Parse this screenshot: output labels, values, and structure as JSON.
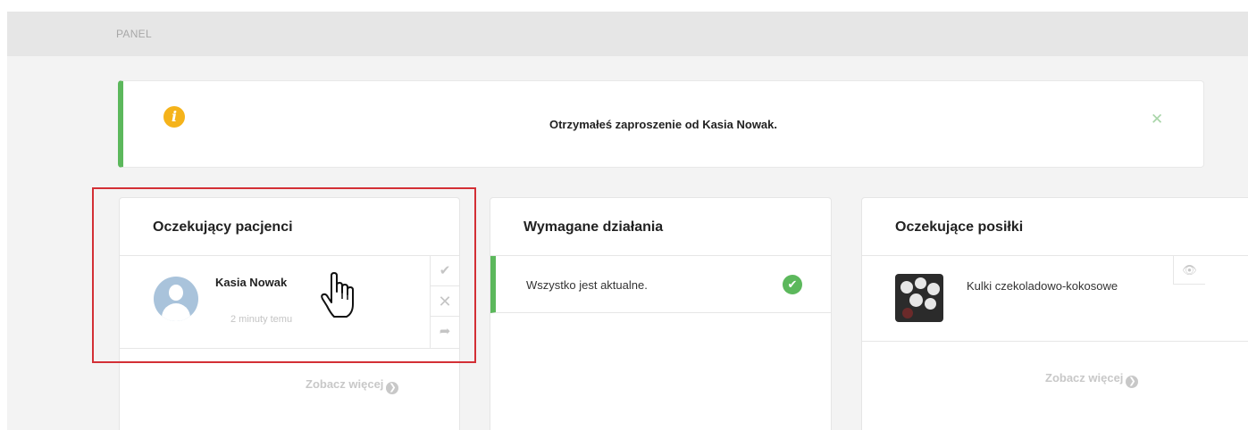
{
  "breadcrumb": {
    "label": "PANEL"
  },
  "alert": {
    "message": "Otrzymałeś zaproszenie od Kasia Nowak.",
    "info_glyph": "i",
    "close_glyph": "✕",
    "accent_color": "#5cb85c",
    "icon": "info-icon"
  },
  "patients_card": {
    "title": "Oczekujący pacjenci",
    "items": [
      {
        "name": "Kasia Nowak",
        "time": "2 minuty temu"
      }
    ],
    "actions": {
      "accept": "✔",
      "reject": "✕",
      "forward": "➦"
    },
    "see_more": "Zobacz więcej",
    "see_more_glyph": "❯"
  },
  "required_actions_card": {
    "title": "Wymagane działania",
    "items": [
      {
        "text": "Wszystko jest aktualne.",
        "status_glyph": "✔"
      }
    ]
  },
  "meals_card": {
    "title": "Oczekujące posiłki",
    "items": [
      {
        "name": "Kulki czekoladowo-kokosowe"
      }
    ],
    "view_glyph": "👁",
    "see_more": "Zobacz więcej",
    "see_more_glyph": "❯"
  },
  "colors": {
    "success": "#5cb85c",
    "warning": "#f5b31a",
    "highlight_box": "#d32f35"
  }
}
